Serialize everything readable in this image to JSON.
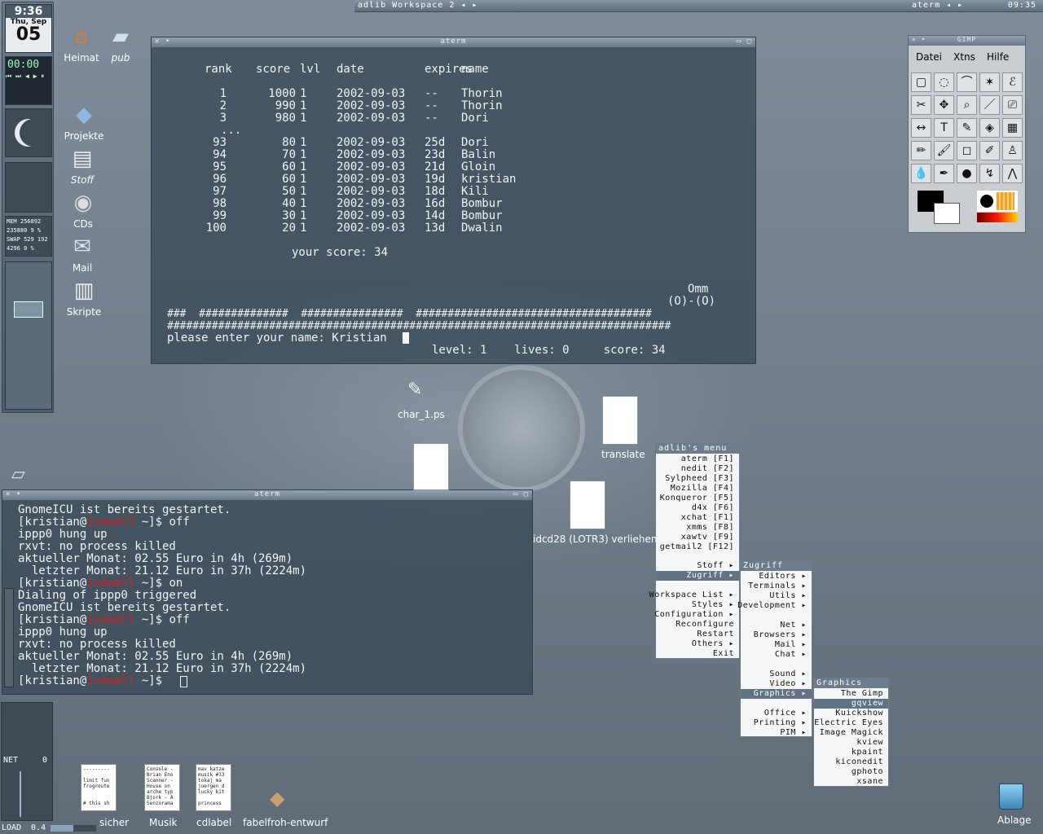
{
  "topbar": {
    "workspace": "adlib Workspace 2 ◂ ▸",
    "app": "aterm ◂ ▸",
    "time": "09:35"
  },
  "dock": {
    "clock": "9:36",
    "date": "Thu, Sep",
    "day": "05",
    "mem": "MEM 256892",
    "mem2": "235880  9 %",
    "swap": "SWAP 529 192",
    "mem3": "4296    0 %",
    "net": "NET",
    "net_val": "0",
    "load": "LOAD",
    "load_val": "0.4",
    "timer": "00:00"
  },
  "desktop_icons": [
    {
      "label": "Heimat",
      "icon": "home-icon"
    },
    {
      "label": "pub",
      "icon": "folder-icon"
    },
    {
      "label": "Projekte",
      "icon": "folder-icon"
    },
    {
      "label": "Stoff",
      "icon": "folder-icon"
    },
    {
      "label": "CDs",
      "icon": "cd-icon"
    },
    {
      "label": "Mail",
      "icon": "mail-icon"
    },
    {
      "label": "Skripte",
      "icon": "script-icon"
    }
  ],
  "aterm_game": {
    "title": "aterm",
    "header": [
      "rank",
      "score",
      "lvl",
      "date",
      "expires",
      "name"
    ],
    "rows": [
      [
        "1",
        "1000",
        "1",
        "2002-09-03",
        "--",
        "Thorin"
      ],
      [
        "2",
        "990",
        "1",
        "2002-09-03",
        "--",
        "Thorin"
      ],
      [
        "3",
        "980",
        "1",
        "2002-09-03",
        "--",
        "Dori"
      ],
      [
        "93",
        "80",
        "1",
        "2002-09-03",
        "25d",
        "Dori"
      ],
      [
        "94",
        "70",
        "1",
        "2002-09-03",
        "23d",
        "Balin"
      ],
      [
        "95",
        "60",
        "1",
        "2002-09-03",
        "21d",
        "Gloin"
      ],
      [
        "96",
        "60",
        "1",
        "2002-09-03",
        "19d",
        "kristian"
      ],
      [
        "97",
        "50",
        "1",
        "2002-09-03",
        "18d",
        "Kili"
      ],
      [
        "98",
        "40",
        "1",
        "2002-09-03",
        "16d",
        "Bombur"
      ],
      [
        "99",
        "30",
        "1",
        "2002-09-03",
        "14d",
        "Bombur"
      ],
      [
        "100",
        "20",
        "1",
        "2002-09-03",
        "13d",
        "Dwalin"
      ]
    ],
    "ellipsis": "...",
    "your_score": "your score: 34",
    "omm": "Omm",
    "omm2": "(O)-(O)",
    "hash1": "###  ##############  ################  #####################################",
    "hash2": "###############################################################################",
    "prompt": "please enter your name: Kristian",
    "status": "level: 1    lives: 0     score: 34"
  },
  "aterm_shell": {
    "title": "aterm",
    "lines": [
      {
        "t": "GnomeICU ist bereits gestartet."
      },
      {
        "p": "[kristian@",
        "h": "icewall",
        "s": " ~]$ off"
      },
      {
        "t": "ippp0 hung up"
      },
      {
        "t": "rxvt: no process killed"
      },
      {
        "t": "aktueller Monat: 02.55 Euro in 4h (269m)"
      },
      {
        "t": "  letzter Monat: 21.12 Euro in 37h (2224m)"
      },
      {
        "p": "[kristian@",
        "h": "icewall",
        "s": " ~]$ on"
      },
      {
        "t": "Dialing of ippp0 triggered"
      },
      {
        "t": "GnomeICU ist bereits gestartet."
      },
      {
        "p": "[kristian@",
        "h": "icewall",
        "s": " ~]$ off"
      },
      {
        "t": "ippp0 hung up"
      },
      {
        "t": "rxvt: no process killed"
      },
      {
        "t": "aktueller Monat: 02.55 Euro in 4h (269m)"
      },
      {
        "t": "  letzter Monat: 21.12 Euro in 37h (2224m)"
      },
      {
        "p": "[kristian@",
        "h": "icewall",
        "s": " ~]$ "
      }
    ]
  },
  "gimp": {
    "title": "GIMP",
    "menu": [
      "Datei",
      "Xtns",
      "Hilfe"
    ]
  },
  "main_menu": {
    "title": "adlib's menu",
    "items": [
      "aterm [F1]",
      "nedit [F2]",
      "Sylpheed [F3]",
      "Mozilla [F4]",
      "Konqueror [F5]",
      "d4x [F6]",
      "xchat [F1]",
      "xmms [F8]",
      "xawtv [F9]",
      "getmail2 [F12]"
    ],
    "items2": [
      "Stoff ▸",
      "Zugriff ▸"
    ],
    "items3": [
      "Workspace List ▸",
      "Styles ▸",
      "Configuration ▸",
      "Reconfigure",
      "Restart",
      "Others ▸",
      "Exit"
    ]
  },
  "zugriff_menu": {
    "title": "Zugriff",
    "items": [
      "Editors ▸",
      "Terminals ▸",
      "Utils ▸",
      "Development ▸"
    ],
    "items2": [
      "Net ▸",
      "Browsers ▸",
      "Mail ▸",
      "Chat ▸"
    ],
    "items3": [
      "Sound ▸",
      "Video ▸",
      "Graphics ▸"
    ],
    "items4": [
      "Office ▸",
      "Printing ▸",
      "PIM ▸"
    ]
  },
  "graphics_menu": {
    "title": "Graphics",
    "items": [
      "The Gimp",
      "gqview",
      "Kuickshow",
      "Electric Eyes",
      "Image Magick",
      "kview",
      "kpaint",
      "kiconedit",
      "gphoto",
      "xsane"
    ]
  },
  "files": {
    "char": "char_1.ps",
    "translate": "translate",
    "cd": "idcd28 (LOTR3) verliehen",
    "sicher": "sicher",
    "musik": "Musik",
    "cdlabel": "cdlabel",
    "fabel": "fabelfroh-entwurf",
    "trash": "Ablage",
    "doc1": "---------\n\nlimit fun\nfrogroute\n\n\n# this sh",
    "doc2": "Console -\nBrian Eno\nScanner -\nHouse on\narche typ\nBjork - A\nSenzorama",
    "doc3": "mav katze\nmusik #33\ntokaj ma\njuergen d\nlucky kit\n\nprincess"
  }
}
